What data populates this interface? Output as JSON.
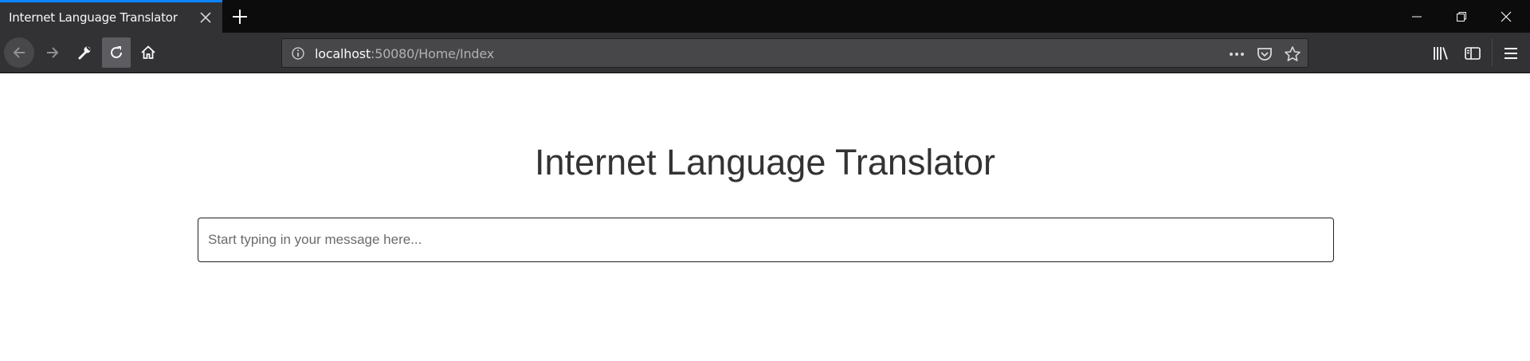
{
  "browser": {
    "tab": {
      "title": "Internet Language Translator"
    },
    "url": {
      "host": "localhost",
      "rest": ":50080/Home/Index"
    },
    "icons": {
      "tab_close": "close-icon",
      "new_tab": "plus-icon",
      "minimize": "minimize-icon",
      "restore": "restore-icon",
      "close_window": "close-icon",
      "back": "arrow-left-icon",
      "forward": "arrow-right-icon",
      "tools": "wrench-icon",
      "reload": "reload-icon",
      "home": "home-icon",
      "site_info": "info-icon",
      "page_actions": "more-dots-icon",
      "pocket": "pocket-icon",
      "bookmark": "star-icon",
      "library": "library-icon",
      "sidebar": "sidebar-icon",
      "menu": "hamburger-icon"
    },
    "colors": {
      "tab_accent": "#0a84ff",
      "toolbar": "#323234",
      "titlebar": "#0c0c0d"
    }
  },
  "page": {
    "title": "Internet Language Translator",
    "input": {
      "placeholder": "Start typing in your message here...",
      "value": ""
    }
  }
}
